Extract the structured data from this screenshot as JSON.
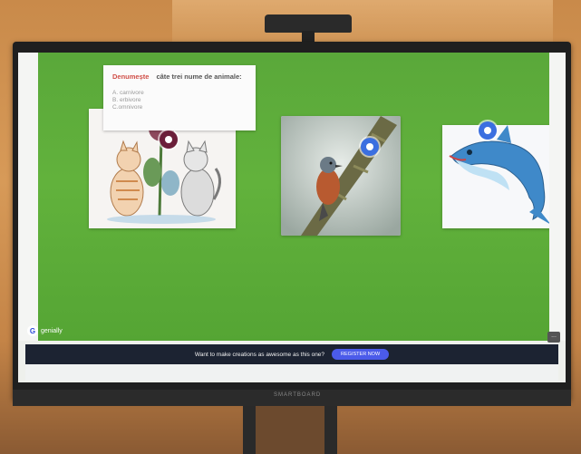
{
  "instructions": {
    "title_accent": "Denumește",
    "title_rest": "câte trei nume de animale:",
    "items": [
      "A. carnivore",
      "B. erbivore",
      "C.omnivore"
    ]
  },
  "images": [
    {
      "name": "cats-flower",
      "icon": "cats-with-flower"
    },
    {
      "name": "bird-branch",
      "icon": "bird-on-branch"
    },
    {
      "name": "dolphin",
      "icon": "cartoon-dolphin"
    }
  ],
  "brand": {
    "badge_letter": "G",
    "name": "genially"
  },
  "more_label": "...",
  "cta": {
    "text": "Want to make creations as awesome as this one?",
    "button": "REGISTER NOW"
  },
  "monitor_brand": "SMARTBOARD",
  "colors": {
    "slide_bg": "#5fae39",
    "hotspot": "#3b6fe0",
    "cta_bg": "#1c2332",
    "cta_button": "#4b5bea",
    "accent": "#d04f48"
  }
}
